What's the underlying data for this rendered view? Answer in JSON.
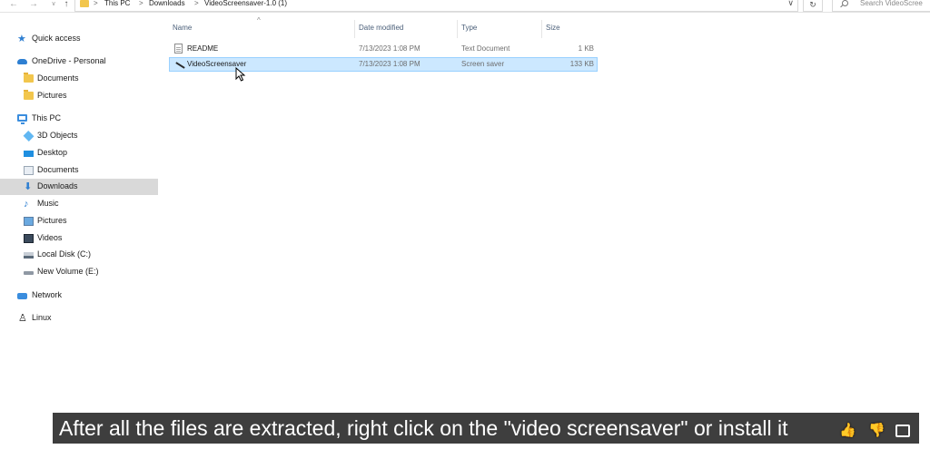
{
  "address_bar": {
    "back_glyph": "←",
    "forward_glyph": "→",
    "recent_glyph": "∨",
    "up_glyph": "↑",
    "breadcrumbs": [
      "This PC",
      "Downloads",
      "VideoScreensaver-1.0 (1)"
    ],
    "separator": ">",
    "dropdown_glyph": "∨",
    "refresh_glyph": "↻",
    "search_placeholder": "Search VideoScree"
  },
  "sidebar": {
    "items": [
      {
        "label": "Quick access",
        "icon": "star-icon"
      },
      {
        "label": "OneDrive - Personal",
        "icon": "cloud-icon"
      },
      {
        "label": "Documents",
        "icon": "folder-icon"
      },
      {
        "label": "Pictures",
        "icon": "folder-icon"
      },
      {
        "label": "This PC",
        "icon": "computer-icon"
      },
      {
        "label": "3D Objects",
        "icon": "cube-icon"
      },
      {
        "label": "Desktop",
        "icon": "desktop-icon"
      },
      {
        "label": "Documents",
        "icon": "documents-icon"
      },
      {
        "label": "Downloads",
        "icon": "download-icon",
        "selected": true
      },
      {
        "label": "Music",
        "icon": "music-note-icon"
      },
      {
        "label": "Pictures",
        "icon": "pictures-icon"
      },
      {
        "label": "Videos",
        "icon": "videos-icon"
      },
      {
        "label": "Local Disk (C:)",
        "icon": "disk-icon"
      },
      {
        "label": "New Volume (E:)",
        "icon": "drive-icon"
      },
      {
        "label": "Network",
        "icon": "network-icon"
      },
      {
        "label": "Linux",
        "icon": "linux-penguin-icon"
      }
    ]
  },
  "file_list": {
    "columns": {
      "name": "Name",
      "date_modified": "Date modified",
      "type": "Type",
      "size": "Size"
    },
    "sort_glyph": "^",
    "rows": [
      {
        "name": "README",
        "date_modified": "7/13/2023 1:08 PM",
        "type": "Text Document",
        "size": "1 KB",
        "icon": "text-document-icon"
      },
      {
        "name": "VideoScreensaver",
        "date_modified": "7/13/2023 1:08 PM",
        "type": "Screen saver",
        "size": "133 KB",
        "icon": "screensaver-icon",
        "selected": true
      }
    ]
  },
  "caption": {
    "text": "After all the files are extracted, right click on the \"video screensaver\" or install it"
  },
  "overlay": {
    "like_glyph": "👍",
    "dislike_glyph": "👎"
  },
  "colors": {
    "selection_bg": "#cce8ff",
    "selection_border": "#99d1ff",
    "sidebar_selected": "#d9d9d9",
    "folder_yellow": "#f2c64d",
    "accent_blue": "#2f7fd1"
  }
}
